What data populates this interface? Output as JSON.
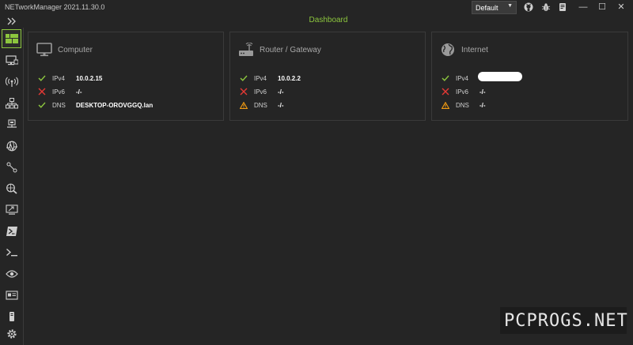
{
  "app": {
    "title": "NETworkManager 2021.11.30.0",
    "profile": "Default"
  },
  "view": {
    "title": "Dashboard"
  },
  "titlebar_icons": [
    "github-icon",
    "bug-icon",
    "book-icon"
  ],
  "window_controls": {
    "minimize": "—",
    "maximize": "☐",
    "close": "✕"
  },
  "sidebar": {
    "items": [
      {
        "name": "dashboard",
        "icon": "dashboard-icon",
        "active": true
      },
      {
        "name": "network-interface",
        "icon": "monitor-network-icon",
        "active": false
      },
      {
        "name": "wifi",
        "icon": "wifi-antenna-icon",
        "active": false
      },
      {
        "name": "ip-scanner",
        "icon": "sitemap-icon",
        "active": false
      },
      {
        "name": "port-scanner",
        "icon": "ethernet-port-icon",
        "active": false
      },
      {
        "name": "ping-monitor",
        "icon": "globe-pulse-icon",
        "active": false
      },
      {
        "name": "traceroute",
        "icon": "route-icon",
        "active": false
      },
      {
        "name": "dns-lookup",
        "icon": "search-globe-icon",
        "active": false
      },
      {
        "name": "remote-desktop",
        "icon": "remote-desktop-icon",
        "active": false
      },
      {
        "name": "powershell",
        "icon": "powershell-icon",
        "active": false
      },
      {
        "name": "putty",
        "icon": "terminal-icon",
        "active": false
      },
      {
        "name": "tightvnc",
        "icon": "eye-icon",
        "active": false
      },
      {
        "name": "web-console",
        "icon": "browser-card-icon",
        "active": false
      },
      {
        "name": "sntp",
        "icon": "device-icon",
        "active": false
      }
    ],
    "settings_icon": "gear-icon"
  },
  "colors": {
    "accent": "#8cc63e",
    "ok": "#8cc63e",
    "error": "#e53935",
    "warning": "#f39c12",
    "background": "#252525"
  },
  "cards": [
    {
      "title": "Computer",
      "icon": "monitor-icon",
      "rows": [
        {
          "label": "IPv4",
          "value": "10.0.2.15",
          "status": "ok"
        },
        {
          "label": "IPv6",
          "value": "-/-",
          "status": "error"
        },
        {
          "label": "DNS",
          "value": "DESKTOP-OROVGGQ.lan",
          "status": "ok"
        }
      ]
    },
    {
      "title": "Router / Gateway",
      "icon": "router-icon",
      "rows": [
        {
          "label": "IPv4",
          "value": "10.0.2.2",
          "status": "ok"
        },
        {
          "label": "IPv6",
          "value": "-/-",
          "status": "error"
        },
        {
          "label": "DNS",
          "value": "-/-",
          "status": "warning"
        }
      ]
    },
    {
      "title": "Internet",
      "icon": "globe-icon",
      "rows": [
        {
          "label": "IPv4",
          "value": "",
          "status": "ok",
          "redacted": true
        },
        {
          "label": "IPv6",
          "value": "-/-",
          "status": "error"
        },
        {
          "label": "DNS",
          "value": "-/-",
          "status": "warning"
        }
      ]
    }
  ],
  "watermark": "PCPROGS.NET"
}
